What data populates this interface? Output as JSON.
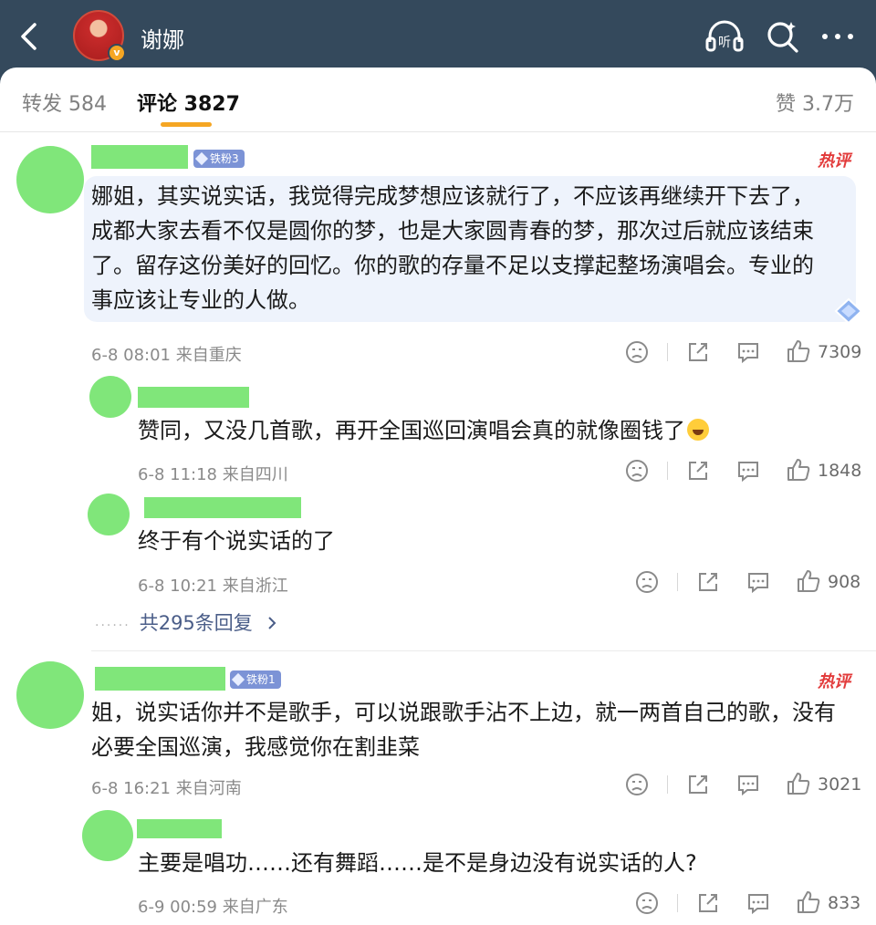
{
  "header": {
    "author_name": "谢娜",
    "verify_badge": "v"
  },
  "tabs": {
    "repost": "转发 584",
    "comments": "评论 3827",
    "likes": "赞 3.7万"
  },
  "comments": [
    {
      "fan_badge": "铁粉3",
      "hot_label": "热评",
      "text": "娜姐，其实说实话，我觉得完成梦想应该就行了，不应该再继续开下去了，成都大家去看不仅是圆你的梦，也是大家圆青春的梦，那次过后就应该结束了。留存这份美好的回忆。你的歌的存量不足以支撑起整场演唱会。专业的事应该让专业的人做。",
      "time": "6-8 08:01 来自重庆",
      "likes": "7309",
      "replies": [
        {
          "text": "赞同，又没几首歌，再开全国巡回演唱会真的就像圈钱了",
          "time": "6-8 11:18 来自四川",
          "likes": "1848"
        },
        {
          "text": "终于有个说实话的了",
          "time": "6-8 10:21 来自浙江",
          "likes": "908"
        }
      ],
      "more_replies": "共295条回复",
      "more_dots": "······"
    },
    {
      "fan_badge": "铁粉1",
      "hot_label": "热评",
      "text": "姐，说实话你并不是歌手，可以说跟歌手沾不上边，就一两首自己的歌，没有必要全国巡演，我感觉你在割韭菜",
      "time": "6-8 16:21 来自河南",
      "likes": "3021",
      "replies": [
        {
          "text": "主要是唱功……还有舞蹈……是不是身边没有说实话的人?",
          "time": "6-9 00:59 来自广东",
          "likes": "833"
        }
      ]
    }
  ],
  "colors": {
    "header_bg": "#34495c",
    "accent": "#f5a623",
    "hot": "#e23b3b",
    "link": "#4a5d88",
    "placeholder_green": "#80e67a"
  },
  "icons": [
    "back-icon",
    "listen-icon",
    "search-icon",
    "more-icon",
    "dislike-icon",
    "share-icon",
    "comment-icon",
    "like-icon",
    "chevron-right-icon"
  ]
}
